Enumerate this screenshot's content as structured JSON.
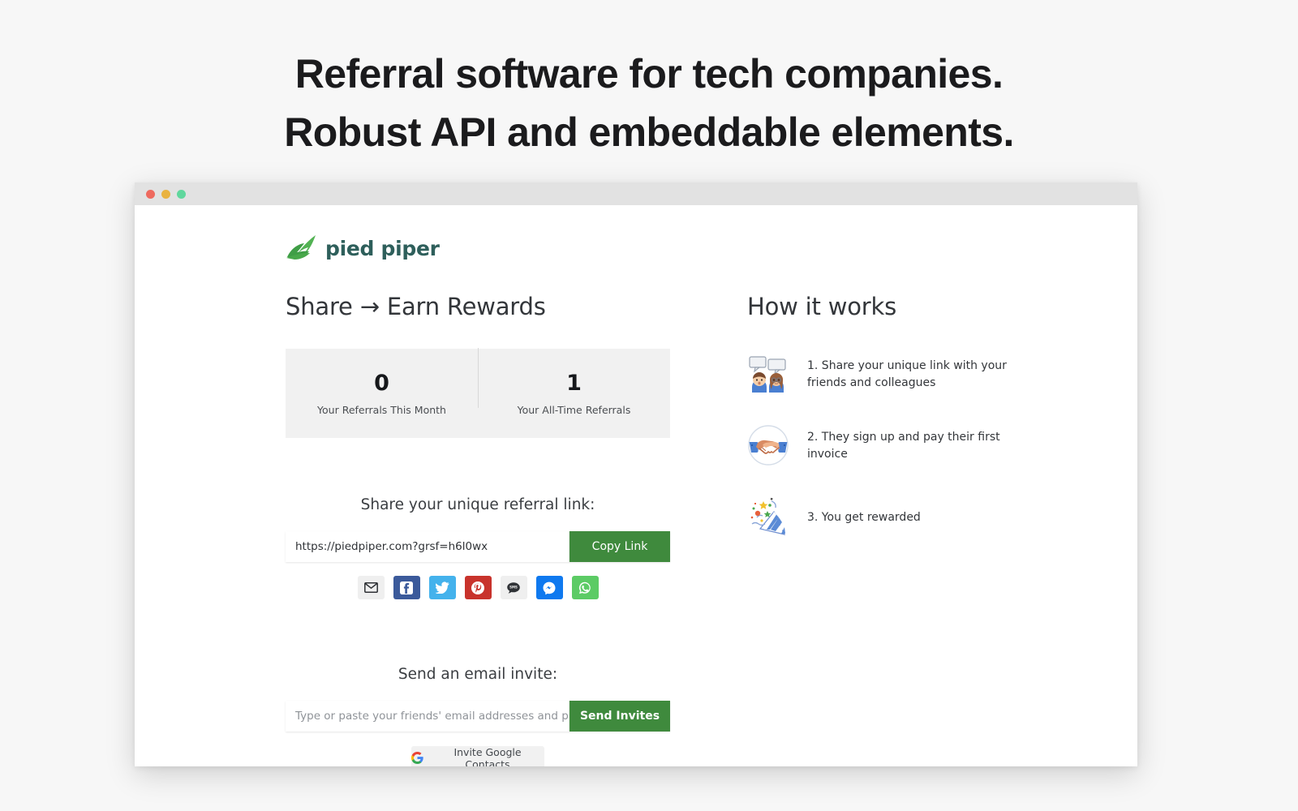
{
  "headline": {
    "line1": "Referral software for tech companies.",
    "line2": "Robust API and embeddable elements."
  },
  "browser": {
    "traffic_lights": [
      "close-red",
      "minimize-yellow",
      "maximize-green"
    ],
    "colors": {
      "red": "#ee6a5f",
      "yellow": "#e9b341",
      "green": "#60d79d",
      "titlebar": "#e2e2e2"
    }
  },
  "brand": {
    "name": "pied piper",
    "logo_icon": "leaf-icon",
    "leaf_color": "#46a749",
    "text_color": "#2e5f5b"
  },
  "left": {
    "title": "Share → Earn Rewards",
    "stats": [
      {
        "value": "0",
        "label": "Your Referrals This Month"
      },
      {
        "value": "1",
        "label": "Your All-Time Referrals"
      }
    ],
    "share": {
      "label": "Share your unique referral link:",
      "link_value": "https://piedpiper.com?grsf=h6l0wx",
      "copy_label": "Copy Link"
    },
    "social": [
      {
        "name": "email",
        "icon": "envelope-icon",
        "color": "#efefef"
      },
      {
        "name": "facebook",
        "icon": "facebook-icon",
        "color": "#3b5a9b"
      },
      {
        "name": "twitter",
        "icon": "twitter-icon",
        "color": "#44b2ec"
      },
      {
        "name": "pinterest",
        "icon": "pinterest-icon",
        "color": "#c8332c"
      },
      {
        "name": "sms",
        "icon": "sms-bubble-icon",
        "color": "#efefef"
      },
      {
        "name": "messenger",
        "icon": "messenger-icon",
        "color": "#0f79ef"
      },
      {
        "name": "whatsapp",
        "icon": "whatsapp-icon",
        "color": "#5ccb65"
      }
    ],
    "invite": {
      "label": "Send an email invite:",
      "placeholder": "Type or paste your friends' email addresses and pre",
      "send_label": "Send Invites",
      "google_label": "Invite Google Contacts",
      "google_icon": "google-g-icon"
    }
  },
  "right": {
    "title": "How it works",
    "steps": [
      {
        "icon": "speaking-heads-icon",
        "text": "1. Share your unique link with your friends and colleagues"
      },
      {
        "icon": "handshake-icon",
        "text": "2. They sign up and pay their first invoice"
      },
      {
        "icon": "party-popper-icon",
        "text": "3. You get rewarded"
      }
    ]
  },
  "accent": {
    "green": "#3f8a3d",
    "page_bg": "#f7f7f7"
  }
}
